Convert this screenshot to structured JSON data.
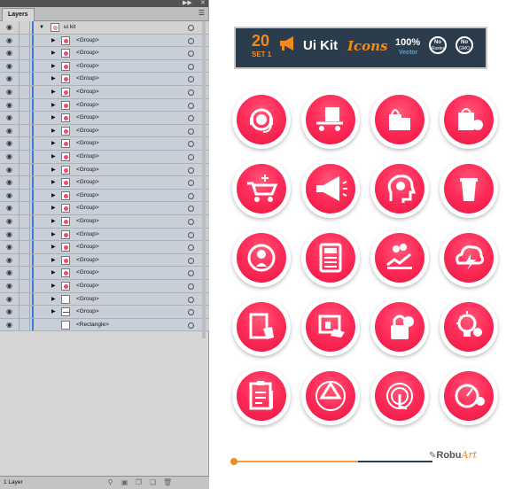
{
  "layers_panel": {
    "tab_label": "Layers",
    "top_layer_label": "ui kit",
    "rows": [
      {
        "label": "<Group>",
        "thumb": "dot"
      },
      {
        "label": "<Group>",
        "thumb": "dot"
      },
      {
        "label": "<Group>",
        "thumb": "dot"
      },
      {
        "label": "<Group>",
        "thumb": "dot"
      },
      {
        "label": "<Group>",
        "thumb": "dot"
      },
      {
        "label": "<Group>",
        "thumb": "dot"
      },
      {
        "label": "<Group>",
        "thumb": "dot"
      },
      {
        "label": "<Group>",
        "thumb": "dot"
      },
      {
        "label": "<Group>",
        "thumb": "dot"
      },
      {
        "label": "<Group>",
        "thumb": "dot"
      },
      {
        "label": "<Group>",
        "thumb": "dot"
      },
      {
        "label": "<Group>",
        "thumb": "dot"
      },
      {
        "label": "<Group>",
        "thumb": "dot"
      },
      {
        "label": "<Group>",
        "thumb": "dot"
      },
      {
        "label": "<Group>",
        "thumb": "dot"
      },
      {
        "label": "<Group>",
        "thumb": "dot"
      },
      {
        "label": "<Group>",
        "thumb": "dot"
      },
      {
        "label": "<Group>",
        "thumb": "dot"
      },
      {
        "label": "<Group>",
        "thumb": "dot"
      },
      {
        "label": "<Group>",
        "thumb": "dot"
      },
      {
        "label": "<Group>",
        "thumb": "blank"
      },
      {
        "label": "<Group>",
        "thumb": "line"
      }
    ],
    "rectangle_label": "<Rectangle>",
    "status_text": "1 Layer"
  },
  "banner": {
    "number": "20",
    "set": "SET 1",
    "title_a": "Ui Kit",
    "title_b": "Icons",
    "percent": "100%",
    "vector": "Vector",
    "badge1_top": "No",
    "badge1_bottom": "Raster",
    "badge2_top": "No",
    "badge2_bottom": "GMO"
  },
  "icons": [
    "headset-support-icon",
    "delivery-cart-icon",
    "shopping-bags-icon",
    "bag-discount-icon",
    "add-to-cart-icon",
    "megaphone-icon",
    "idea-head-icon",
    "trash-bin-icon",
    "location-chat-icon",
    "calculator-icon",
    "money-chart-icon",
    "cloud-lightning-icon",
    "tablet-touch-icon",
    "credit-card-hand-icon",
    "lock-icon",
    "lightbulb-gear-icon",
    "clipboard-icon",
    "recycle-icon",
    "touch-tap-icon",
    "gauge-coins-icon"
  ],
  "logo": {
    "part1": "Robu",
    "part2": "Art"
  },
  "slider": {
    "progress": 0.63
  },
  "colors": {
    "accent": "#f08a1e",
    "icon_red": "#ff2d5a",
    "banner_bg": "#2b3d4c",
    "layer_blue": "#3c7ad8"
  }
}
